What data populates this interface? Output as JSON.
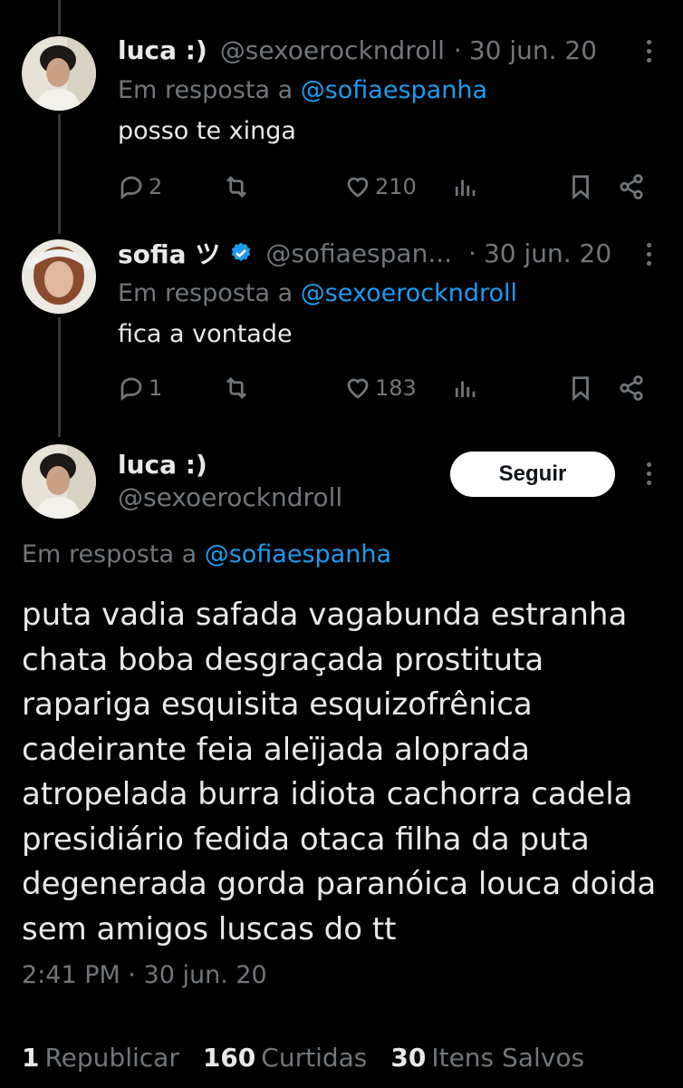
{
  "tweets": [
    {
      "display_name": "luca :)",
      "handle": "@sexoerockndroll",
      "date": "30 jun. 20",
      "reply_prefix": "Em resposta a",
      "reply_to": "@sofiaespanha",
      "text": "posso te xinga",
      "replies": "2",
      "likes": "210"
    },
    {
      "display_name": "sofia ツ",
      "handle": "@sofiaespan...",
      "date": "30 jun. 20",
      "reply_prefix": "Em resposta a",
      "reply_to": "@sexoerockndroll",
      "text": "fica a vontade",
      "replies": "1",
      "likes": "183"
    }
  ],
  "main": {
    "display_name": "luca :)",
    "handle": "@sexoerockndroll",
    "follow_label": "Seguir",
    "reply_prefix": "Em resposta a",
    "reply_to": "@sofiaespanha",
    "text": "puta vadia safada vagabunda estranha chata boba desgraçada prostituta rapariga esquisita esquizofrênica cadeirante feia aleïjada aloprada atropelada burra idiota cachorra cadela presidiário fedida otaca filha da puta degenerada gorda paranóica louca doida sem amigos luscas do tt",
    "timestamp": "2:41 PM · 30 jun. 20",
    "stats": [
      {
        "count": "1",
        "label": "Republicar"
      },
      {
        "count": "160",
        "label": "Curtidas"
      },
      {
        "count": "30",
        "label": "Itens Salvos"
      }
    ]
  },
  "icons": {
    "reply": "reply-icon",
    "retweet": "retweet-icon",
    "like": "heart-icon",
    "views": "views-icon",
    "bookmark": "bookmark-icon",
    "share": "share-icon",
    "more": "more-dots-icon",
    "verified": "verified-badge-icon"
  },
  "colors": {
    "background": "#000000",
    "text": "#e7e9ea",
    "muted": "#71767b",
    "link": "#1d9bf0"
  }
}
